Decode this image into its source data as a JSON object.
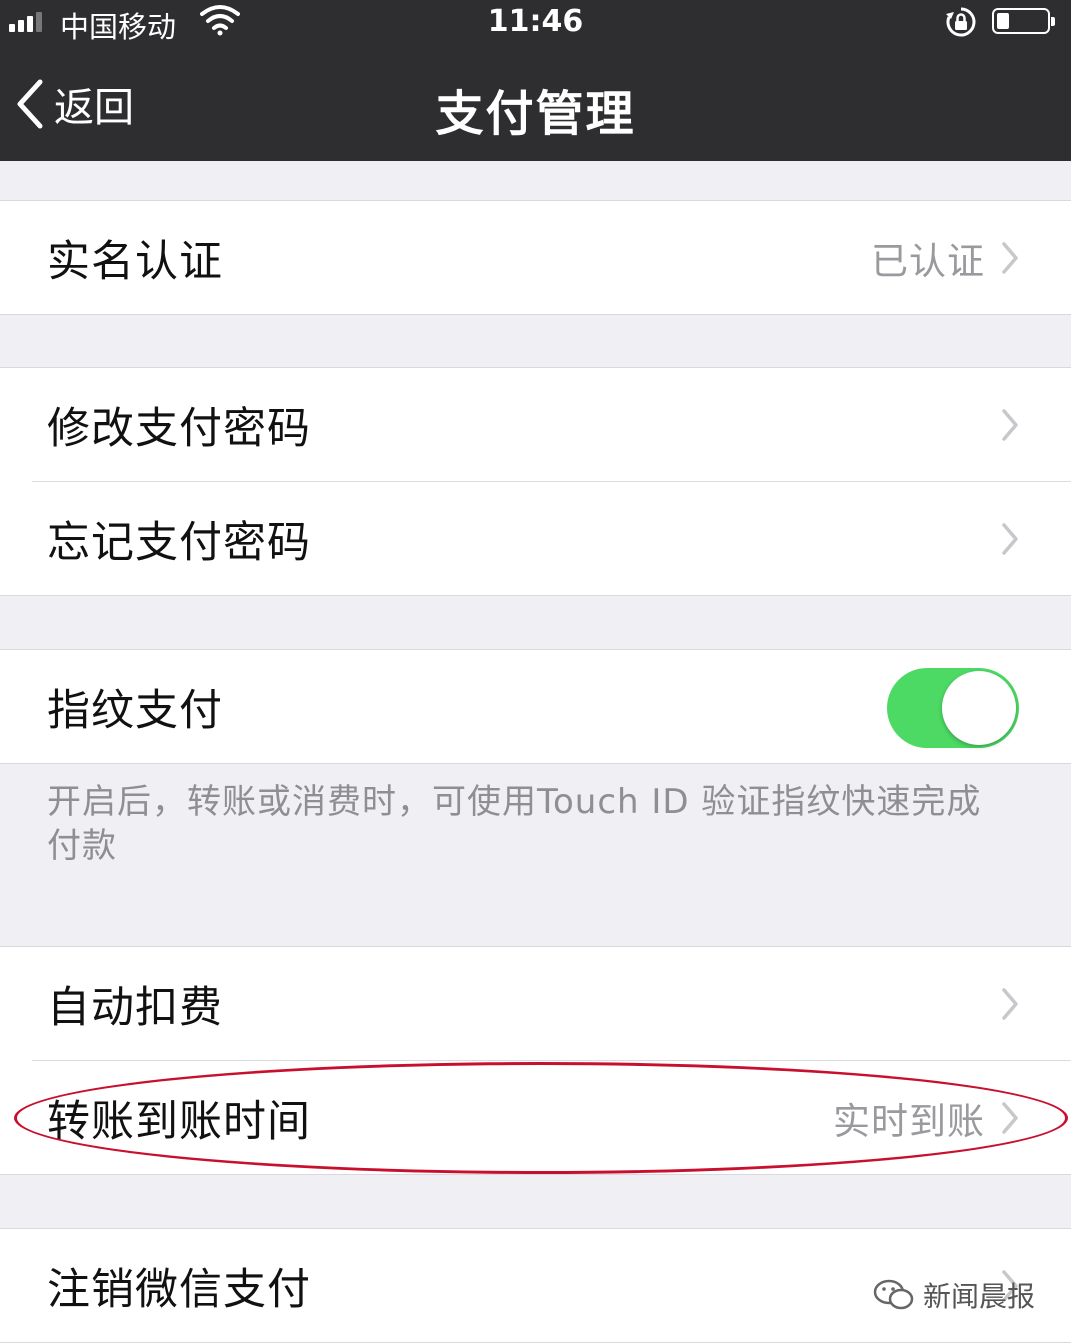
{
  "status_bar": {
    "carrier": "中国移动",
    "time": "11:46"
  },
  "nav": {
    "back_label": "返回",
    "title": "支付管理"
  },
  "sections": {
    "identity": {
      "label": "实名认证",
      "value": "已认证"
    },
    "change_password": {
      "label": "修改支付密码"
    },
    "forgot_password": {
      "label": "忘记支付密码"
    },
    "fingerprint": {
      "label": "指纹支付",
      "enabled": true,
      "footnote": "开启后，转账或消费时，可使用Touch ID 验证指纹快速完成付款"
    },
    "auto_deduct": {
      "label": "自动扣费"
    },
    "transfer_time": {
      "label": "转账到账时间",
      "value": "实时到账"
    },
    "cancel": {
      "label": "注销微信支付"
    }
  },
  "watermark": "新闻晨报",
  "colors": {
    "navbar": "#2e2e30",
    "background": "#efeff4",
    "toggle_on": "#4cd964",
    "annotation": "#c8102e"
  }
}
